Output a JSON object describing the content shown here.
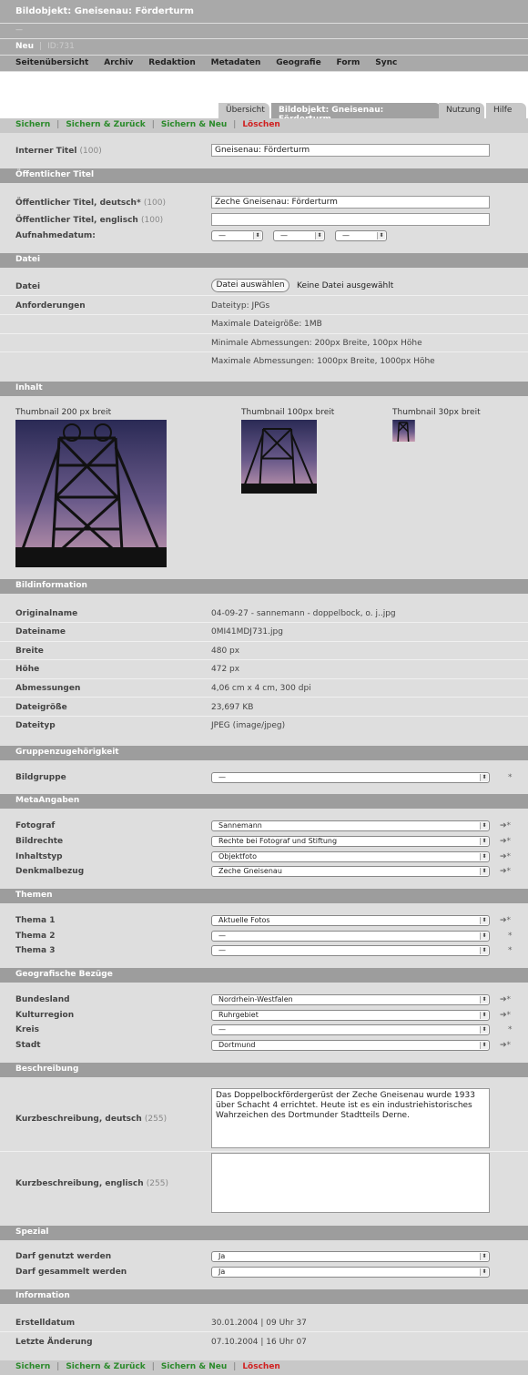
{
  "header": {
    "title": "Bildobjekt: Gneisenau: Förderturm",
    "subtitle": "—",
    "new_label": "Neu",
    "id_label": "ID:731"
  },
  "nav": [
    "Seitenübersicht",
    "Archiv",
    "Redaktion",
    "Metadaten",
    "Geografie",
    "Form",
    "Sync"
  ],
  "tabs": [
    "Übersicht",
    "Bildobjekt: Gneisenau: Förderturm",
    "Nutzung",
    "Hilfe"
  ],
  "actions": {
    "save": "Sichern",
    "save_back": "Sichern & Zurück",
    "save_new": "Sichern & Neu",
    "delete": "Löschen",
    "separator": "|"
  },
  "intern": {
    "label": "Interner Titel",
    "limit": "(100)",
    "value": "Gneisenau: Förderturm"
  },
  "oeffentlich": {
    "section": "Öffentlicher Titel",
    "de_label": "Öffentlicher Titel, deutsch*",
    "de_limit": "(100)",
    "de_value": "Zeche Gneisenau: Förderturm",
    "en_label": "Öffentlicher Titel, englisch",
    "en_limit": "(100)",
    "en_value": "",
    "date_label": "Aufnahmedatum:",
    "date_values": [
      "—",
      "—",
      "—"
    ]
  },
  "datei": {
    "section": "Datei",
    "file_label": "Datei",
    "button": "Datei auswählen",
    "no_file": "Keine Datei ausgewählt",
    "req_label": "Anforderungen",
    "reqs": [
      "Dateityp: JPGs",
      "Maximale Dateigröße: 1MB",
      "Minimale Abmessungen: 200px Breite, 100px Höhe",
      "Maximale Abmessungen: 1000px Breite, 1000px Höhe"
    ]
  },
  "inhalt": {
    "section": "Inhalt",
    "thumb200": "Thumbnail 200 px breit",
    "thumb100": "Thumbnail 100px breit",
    "thumb30": "Thumbnail 30px breit"
  },
  "bildinfo": {
    "section": "Bildinformation",
    "rows": [
      {
        "label": "Originalname",
        "value": "04-09-27 - sannemann - doppelbock, o. j..jpg"
      },
      {
        "label": "Dateiname",
        "value": "0MI41MDJ731.jpg"
      },
      {
        "label": "Breite",
        "value": "480 px"
      },
      {
        "label": "Höhe",
        "value": "472 px"
      },
      {
        "label": "Abmessungen",
        "value": "4,06 cm x 4 cm, 300 dpi"
      },
      {
        "label": "Dateigröße",
        "value": "23,697 KB"
      },
      {
        "label": "Dateityp",
        "value": "JPEG (image/jpeg)"
      }
    ]
  },
  "gruppe": {
    "section": "Gruppenzugehörigkeit",
    "label": "Bildgruppe",
    "value": "—",
    "mark": "*"
  },
  "meta": {
    "section": "MetaAngaben",
    "rows": [
      {
        "label": "Fotograf",
        "value": "Sannemann",
        "mark": "➔*"
      },
      {
        "label": "Bildrechte",
        "value": "Rechte bei Fotograf und Stiftung",
        "mark": "➔*"
      },
      {
        "label": "Inhaltstyp",
        "value": "Objektfoto",
        "mark": "➔*"
      },
      {
        "label": "Denkmalbezug",
        "value": "Zeche Gneisenau",
        "mark": "➔*"
      }
    ]
  },
  "themen": {
    "section": "Themen",
    "rows": [
      {
        "label": "Thema 1",
        "value": "Aktuelle Fotos",
        "mark": "➔*"
      },
      {
        "label": "Thema 2",
        "value": "—",
        "mark": "*"
      },
      {
        "label": "Thema 3",
        "value": "—",
        "mark": "*"
      }
    ]
  },
  "geo": {
    "section": "Geografische Bezüge",
    "rows": [
      {
        "label": "Bundesland",
        "value": "Nordrhein-Westfalen",
        "mark": "➔*"
      },
      {
        "label": "Kulturregion",
        "value": "Ruhrgebiet",
        "mark": "➔*"
      },
      {
        "label": "Kreis",
        "value": "—",
        "mark": "*"
      },
      {
        "label": "Stadt",
        "value": "Dortmund",
        "mark": "➔*"
      }
    ]
  },
  "beschreibung": {
    "section": "Beschreibung",
    "de_label": "Kurzbeschreibung, deutsch",
    "de_limit": "(255)",
    "de_value": "Das Doppelbockfördergerüst der Zeche Gneisenau wurde 1933 über Schacht 4 errichtet. Heute ist es ein industriehistorisches Wahrzeichen des Dortmunder Stadtteils Derne.",
    "en_label": "Kurzbeschreibung, englisch",
    "en_limit": "(255)",
    "en_value": ""
  },
  "spezial": {
    "section": "Spezial",
    "rows": [
      {
        "label": "Darf genutzt werden",
        "value": "Ja"
      },
      {
        "label": "Darf gesammelt werden",
        "value": "Ja"
      }
    ]
  },
  "information": {
    "section": "Information",
    "rows": [
      {
        "label": "Erstelldatum",
        "value": "30.01.2004 | 09 Uhr 37"
      },
      {
        "label": "Letzte Änderung",
        "value": "07.10.2004 | 16 Uhr 07"
      }
    ]
  }
}
